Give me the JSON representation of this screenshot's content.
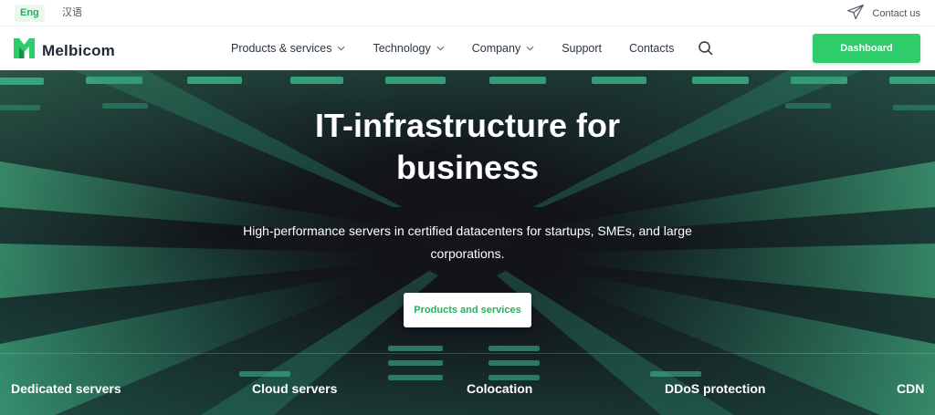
{
  "topbar": {
    "lang_active": "Eng",
    "lang_other": "汉语",
    "contact_label": "Contact us"
  },
  "brand": {
    "name": "Melbicom",
    "accent": "#2fcc6c"
  },
  "nav": {
    "items": [
      {
        "label": "Products & services",
        "has_dropdown": true
      },
      {
        "label": "Technology",
        "has_dropdown": true
      },
      {
        "label": "Company",
        "has_dropdown": true
      },
      {
        "label": "Support",
        "has_dropdown": false
      },
      {
        "label": "Contacts",
        "has_dropdown": false
      }
    ],
    "search_icon": "search-icon",
    "dashboard_label": "Dashboard"
  },
  "hero": {
    "title_line1": "IT-infrastructure for",
    "title_line2": "business",
    "subtitle_line1": "High-performance servers in certified datacenters for startups, SMEs, and large",
    "subtitle_line2": "corporations.",
    "cta_label": "Products and services",
    "categories": [
      "Dedicated servers",
      "Cloud servers",
      "Colocation",
      "DDoS protection",
      "CDN"
    ]
  }
}
